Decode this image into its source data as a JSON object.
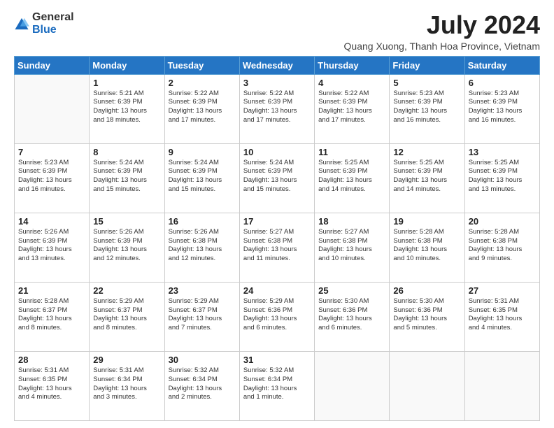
{
  "header": {
    "logo": {
      "general": "General",
      "blue": "Blue"
    },
    "title": "July 2024",
    "location": "Quang Xuong, Thanh Hoa Province, Vietnam"
  },
  "calendar": {
    "days_of_week": [
      "Sunday",
      "Monday",
      "Tuesday",
      "Wednesday",
      "Thursday",
      "Friday",
      "Saturday"
    ],
    "weeks": [
      [
        {
          "day": "",
          "info": ""
        },
        {
          "day": "1",
          "info": "Sunrise: 5:21 AM\nSunset: 6:39 PM\nDaylight: 13 hours\nand 18 minutes."
        },
        {
          "day": "2",
          "info": "Sunrise: 5:22 AM\nSunset: 6:39 PM\nDaylight: 13 hours\nand 17 minutes."
        },
        {
          "day": "3",
          "info": "Sunrise: 5:22 AM\nSunset: 6:39 PM\nDaylight: 13 hours\nand 17 minutes."
        },
        {
          "day": "4",
          "info": "Sunrise: 5:22 AM\nSunset: 6:39 PM\nDaylight: 13 hours\nand 17 minutes."
        },
        {
          "day": "5",
          "info": "Sunrise: 5:23 AM\nSunset: 6:39 PM\nDaylight: 13 hours\nand 16 minutes."
        },
        {
          "day": "6",
          "info": "Sunrise: 5:23 AM\nSunset: 6:39 PM\nDaylight: 13 hours\nand 16 minutes."
        }
      ],
      [
        {
          "day": "7",
          "info": "Sunrise: 5:23 AM\nSunset: 6:39 PM\nDaylight: 13 hours\nand 16 minutes."
        },
        {
          "day": "8",
          "info": "Sunrise: 5:24 AM\nSunset: 6:39 PM\nDaylight: 13 hours\nand 15 minutes."
        },
        {
          "day": "9",
          "info": "Sunrise: 5:24 AM\nSunset: 6:39 PM\nDaylight: 13 hours\nand 15 minutes."
        },
        {
          "day": "10",
          "info": "Sunrise: 5:24 AM\nSunset: 6:39 PM\nDaylight: 13 hours\nand 15 minutes."
        },
        {
          "day": "11",
          "info": "Sunrise: 5:25 AM\nSunset: 6:39 PM\nDaylight: 13 hours\nand 14 minutes."
        },
        {
          "day": "12",
          "info": "Sunrise: 5:25 AM\nSunset: 6:39 PM\nDaylight: 13 hours\nand 14 minutes."
        },
        {
          "day": "13",
          "info": "Sunrise: 5:25 AM\nSunset: 6:39 PM\nDaylight: 13 hours\nand 13 minutes."
        }
      ],
      [
        {
          "day": "14",
          "info": "Sunrise: 5:26 AM\nSunset: 6:39 PM\nDaylight: 13 hours\nand 13 minutes."
        },
        {
          "day": "15",
          "info": "Sunrise: 5:26 AM\nSunset: 6:39 PM\nDaylight: 13 hours\nand 12 minutes."
        },
        {
          "day": "16",
          "info": "Sunrise: 5:26 AM\nSunset: 6:38 PM\nDaylight: 13 hours\nand 12 minutes."
        },
        {
          "day": "17",
          "info": "Sunrise: 5:27 AM\nSunset: 6:38 PM\nDaylight: 13 hours\nand 11 minutes."
        },
        {
          "day": "18",
          "info": "Sunrise: 5:27 AM\nSunset: 6:38 PM\nDaylight: 13 hours\nand 10 minutes."
        },
        {
          "day": "19",
          "info": "Sunrise: 5:28 AM\nSunset: 6:38 PM\nDaylight: 13 hours\nand 10 minutes."
        },
        {
          "day": "20",
          "info": "Sunrise: 5:28 AM\nSunset: 6:38 PM\nDaylight: 13 hours\nand 9 minutes."
        }
      ],
      [
        {
          "day": "21",
          "info": "Sunrise: 5:28 AM\nSunset: 6:37 PM\nDaylight: 13 hours\nand 8 minutes."
        },
        {
          "day": "22",
          "info": "Sunrise: 5:29 AM\nSunset: 6:37 PM\nDaylight: 13 hours\nand 8 minutes."
        },
        {
          "day": "23",
          "info": "Sunrise: 5:29 AM\nSunset: 6:37 PM\nDaylight: 13 hours\nand 7 minutes."
        },
        {
          "day": "24",
          "info": "Sunrise: 5:29 AM\nSunset: 6:36 PM\nDaylight: 13 hours\nand 6 minutes."
        },
        {
          "day": "25",
          "info": "Sunrise: 5:30 AM\nSunset: 6:36 PM\nDaylight: 13 hours\nand 6 minutes."
        },
        {
          "day": "26",
          "info": "Sunrise: 5:30 AM\nSunset: 6:36 PM\nDaylight: 13 hours\nand 5 minutes."
        },
        {
          "day": "27",
          "info": "Sunrise: 5:31 AM\nSunset: 6:35 PM\nDaylight: 13 hours\nand 4 minutes."
        }
      ],
      [
        {
          "day": "28",
          "info": "Sunrise: 5:31 AM\nSunset: 6:35 PM\nDaylight: 13 hours\nand 4 minutes."
        },
        {
          "day": "29",
          "info": "Sunrise: 5:31 AM\nSunset: 6:34 PM\nDaylight: 13 hours\nand 3 minutes."
        },
        {
          "day": "30",
          "info": "Sunrise: 5:32 AM\nSunset: 6:34 PM\nDaylight: 13 hours\nand 2 minutes."
        },
        {
          "day": "31",
          "info": "Sunrise: 5:32 AM\nSunset: 6:34 PM\nDaylight: 13 hours\nand 1 minute."
        },
        {
          "day": "",
          "info": ""
        },
        {
          "day": "",
          "info": ""
        },
        {
          "day": "",
          "info": ""
        }
      ]
    ]
  }
}
